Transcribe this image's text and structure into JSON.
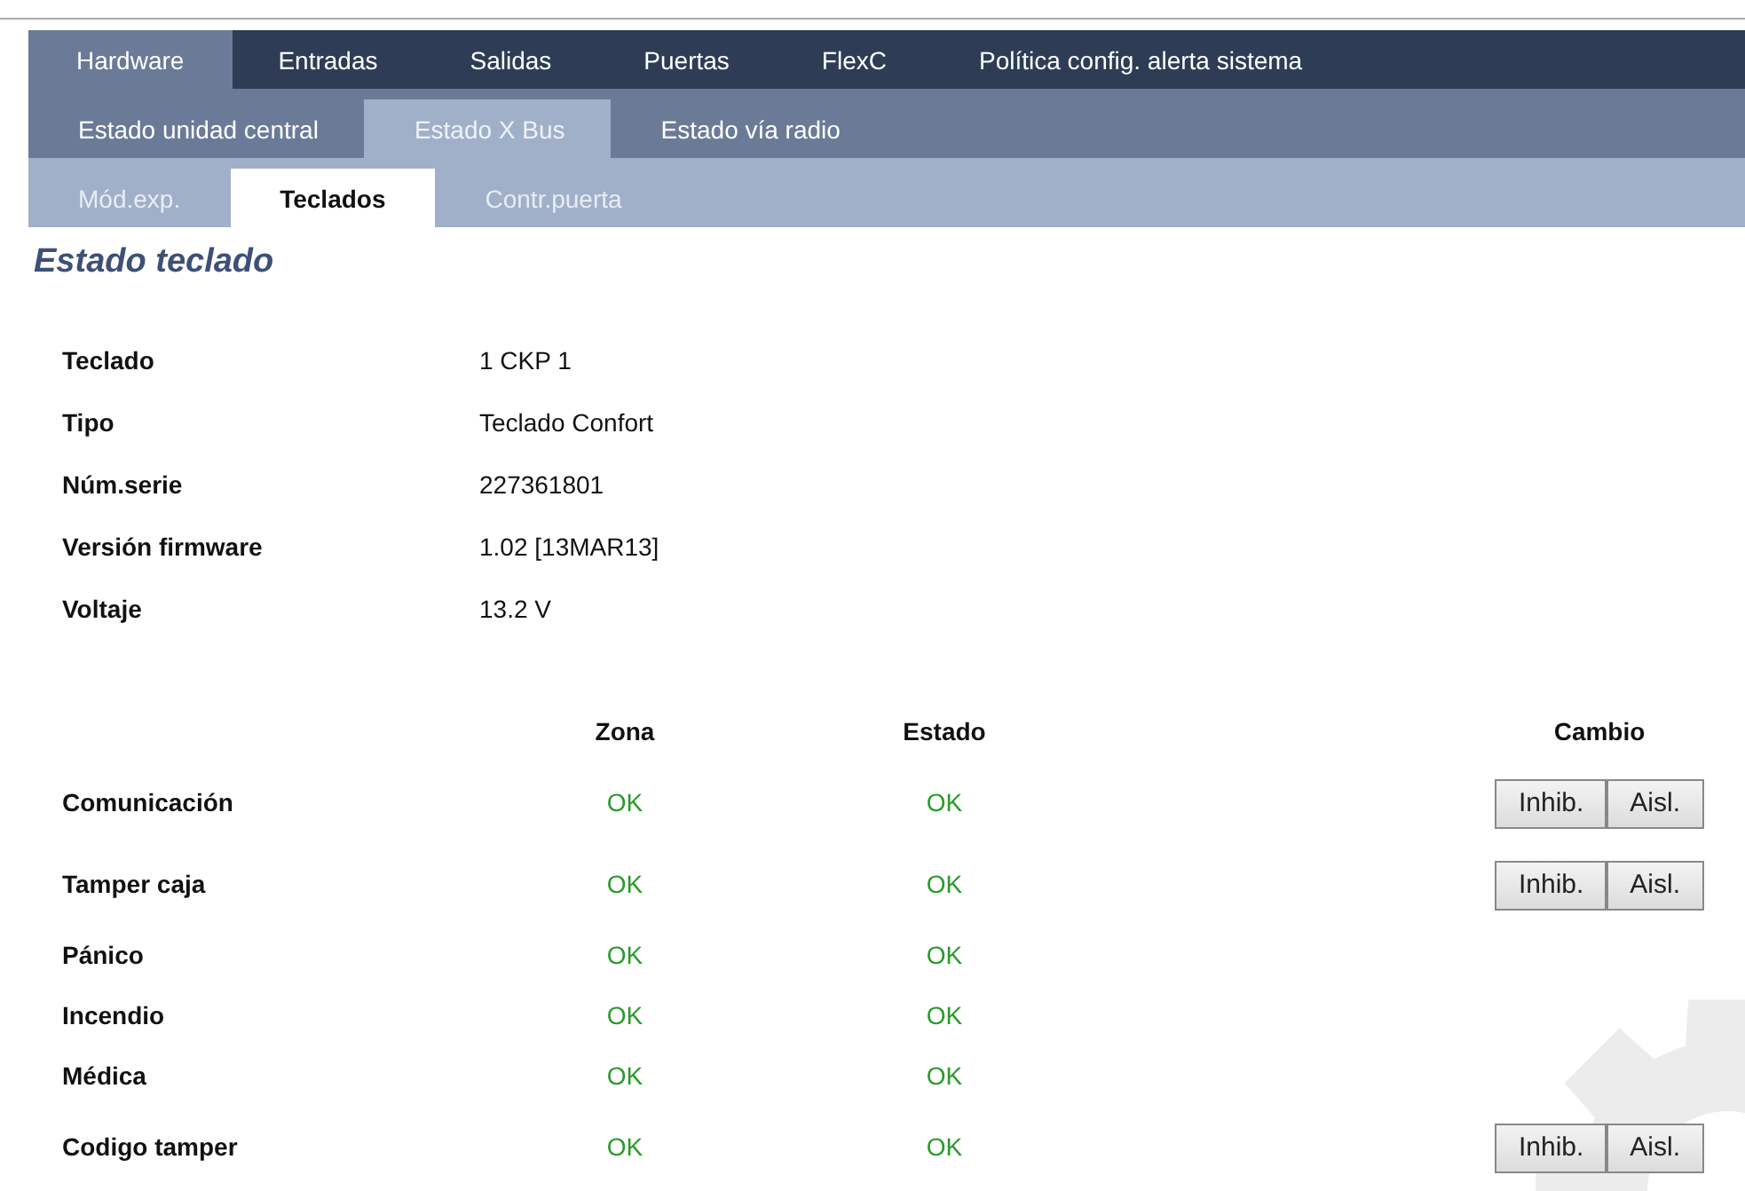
{
  "nav_levels": [
    {
      "tabs": [
        {
          "label": "Hardware",
          "selected": true
        },
        {
          "label": "Entradas",
          "selected": false
        },
        {
          "label": "Salidas",
          "selected": false
        },
        {
          "label": "Puertas",
          "selected": false
        },
        {
          "label": "FlexC",
          "selected": false
        },
        {
          "label": "Política config. alerta sistema",
          "selected": false
        }
      ]
    },
    {
      "tabs": [
        {
          "label": "Estado unidad central",
          "selected": false
        },
        {
          "label": "Estado X Bus",
          "selected": true
        },
        {
          "label": "Estado vía radio",
          "selected": false
        }
      ]
    },
    {
      "tabs": [
        {
          "label": "Mód.exp.",
          "selected": false
        },
        {
          "label": "Teclados",
          "selected": true
        },
        {
          "label": "Contr.puerta",
          "selected": false
        }
      ]
    }
  ],
  "page_title": "Estado teclado",
  "details": [
    {
      "label": "Teclado",
      "value": "1 CKP 1"
    },
    {
      "label": "Tipo",
      "value": "Teclado Confort"
    },
    {
      "label": "Núm.serie",
      "value": "227361801"
    },
    {
      "label": "Versión firmware",
      "value": "1.02 [13MAR13]"
    },
    {
      "label": "Voltaje",
      "value": "13.2 V"
    }
  ],
  "status_table": {
    "columns": [
      "Zona",
      "Estado",
      "Cambio"
    ],
    "rows": [
      {
        "label": "Comunicación",
        "zona": "OK",
        "estado": "OK",
        "buttons": [
          "Inhib.",
          "Aisl."
        ]
      },
      {
        "label": "Tamper caja",
        "zona": "OK",
        "estado": "OK",
        "buttons": [
          "Inhib.",
          "Aisl."
        ]
      },
      {
        "label": "Pánico",
        "zona": "OK",
        "estado": "OK"
      },
      {
        "label": "Incendio",
        "zona": "OK",
        "estado": "OK"
      },
      {
        "label": "Médica",
        "zona": "OK",
        "estado": "OK"
      },
      {
        "label": "Codigo tamper",
        "zona": "OK",
        "estado": "OK",
        "buttons": [
          "Inhib.",
          "Aisl."
        ]
      }
    ]
  }
}
